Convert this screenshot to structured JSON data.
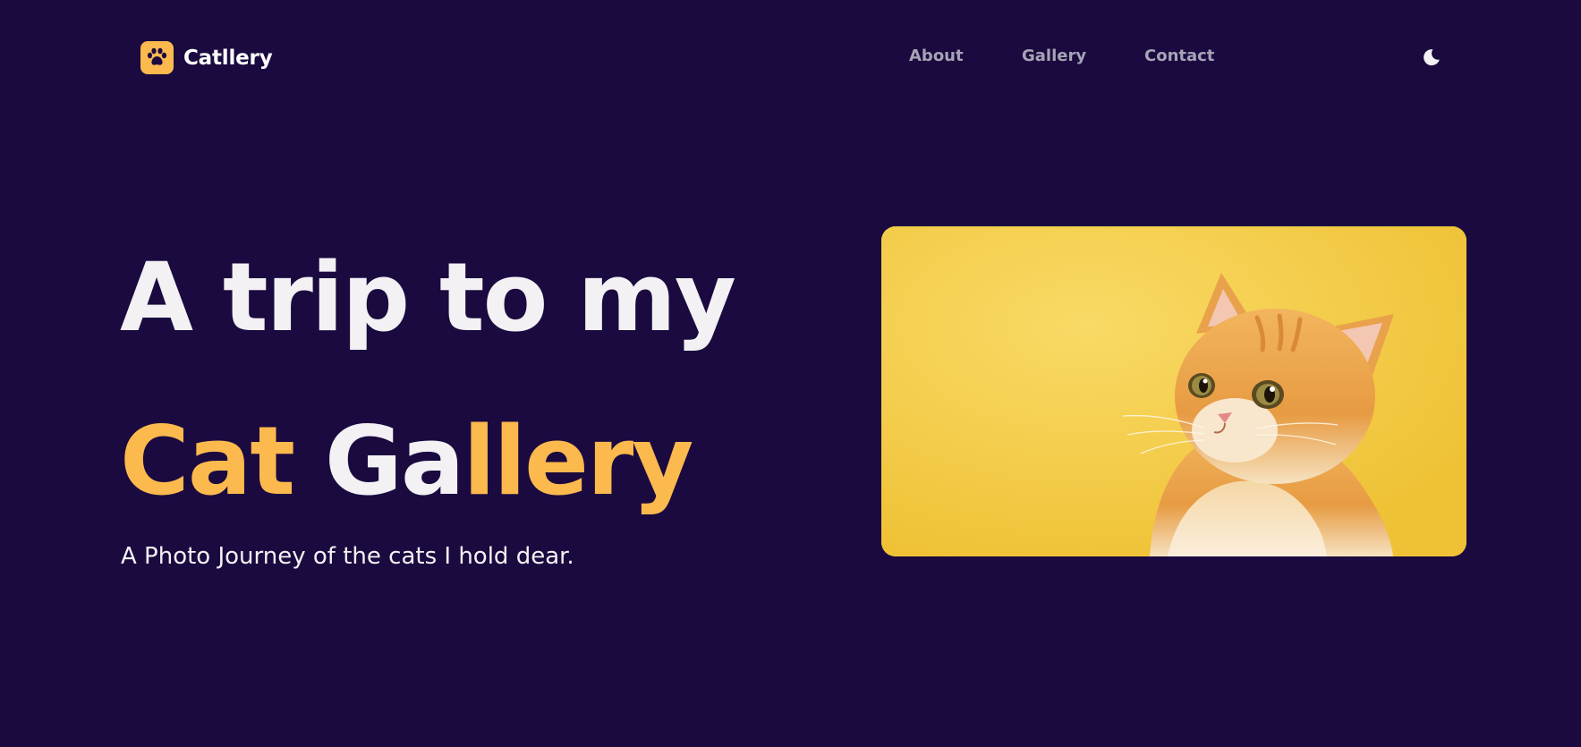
{
  "brand": {
    "name": "Catllery",
    "icon": "paw-icon",
    "badge_color": "#fcb94e"
  },
  "nav": {
    "items": [
      {
        "label": "About"
      },
      {
        "label": "Gallery"
      },
      {
        "label": "Contact"
      }
    ],
    "theme_toggle_icon": "moon-icon"
  },
  "hero": {
    "line1": "A trip to my",
    "line2": {
      "part1": "Cat",
      "part2": "Ga",
      "part3": "llery"
    },
    "subtitle": "A Photo Journey of the cats I hold dear.",
    "accent_color": "#fcb94e",
    "image": {
      "icon": "kitten-photo",
      "background_color": "#f5cb42"
    }
  },
  "colors": {
    "background": "#1a0a3f",
    "text": "#f3f1f4",
    "nav_text": "#a7a3b6"
  }
}
